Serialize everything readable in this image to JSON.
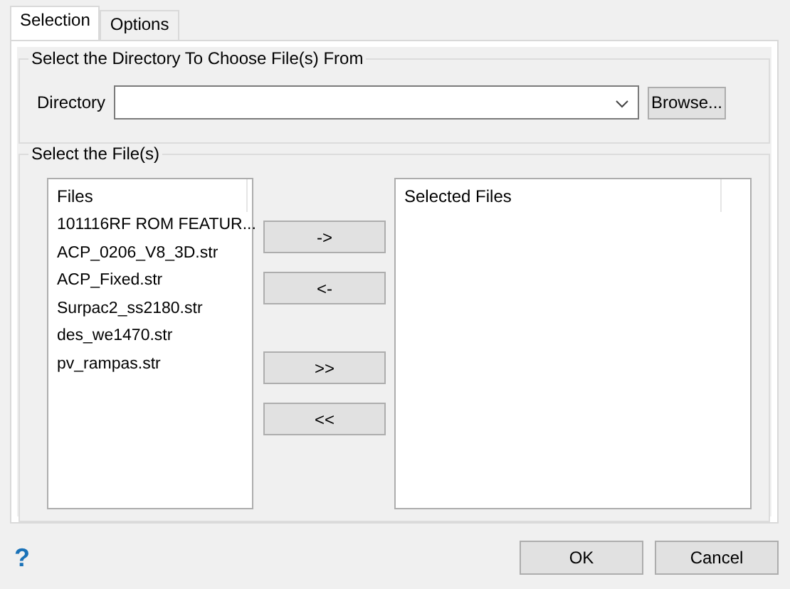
{
  "tabs": [
    {
      "label": "Selection",
      "selected": true
    },
    {
      "label": "Options",
      "selected": false
    }
  ],
  "directory_group": {
    "title": "Select the Directory To Choose File(s) From",
    "label": "Directory",
    "browse_button": "Browse..."
  },
  "files_group": {
    "title": "Select the File(s)",
    "files_list": {
      "header": "Files",
      "items": [
        "101116RF ROM FEATUR...",
        "ACP_0206_V8_3D.str",
        "ACP_Fixed.str",
        "Surpac2_ss2180.str",
        "des_we1470.str",
        "pv_rampas.str"
      ]
    },
    "move_buttons": [
      "->",
      "<-",
      ">>",
      "<<"
    ],
    "selected_list": {
      "header": "Selected Files"
    }
  },
  "help": "?",
  "buttons": [
    "OK",
    "Cancel"
  ]
}
